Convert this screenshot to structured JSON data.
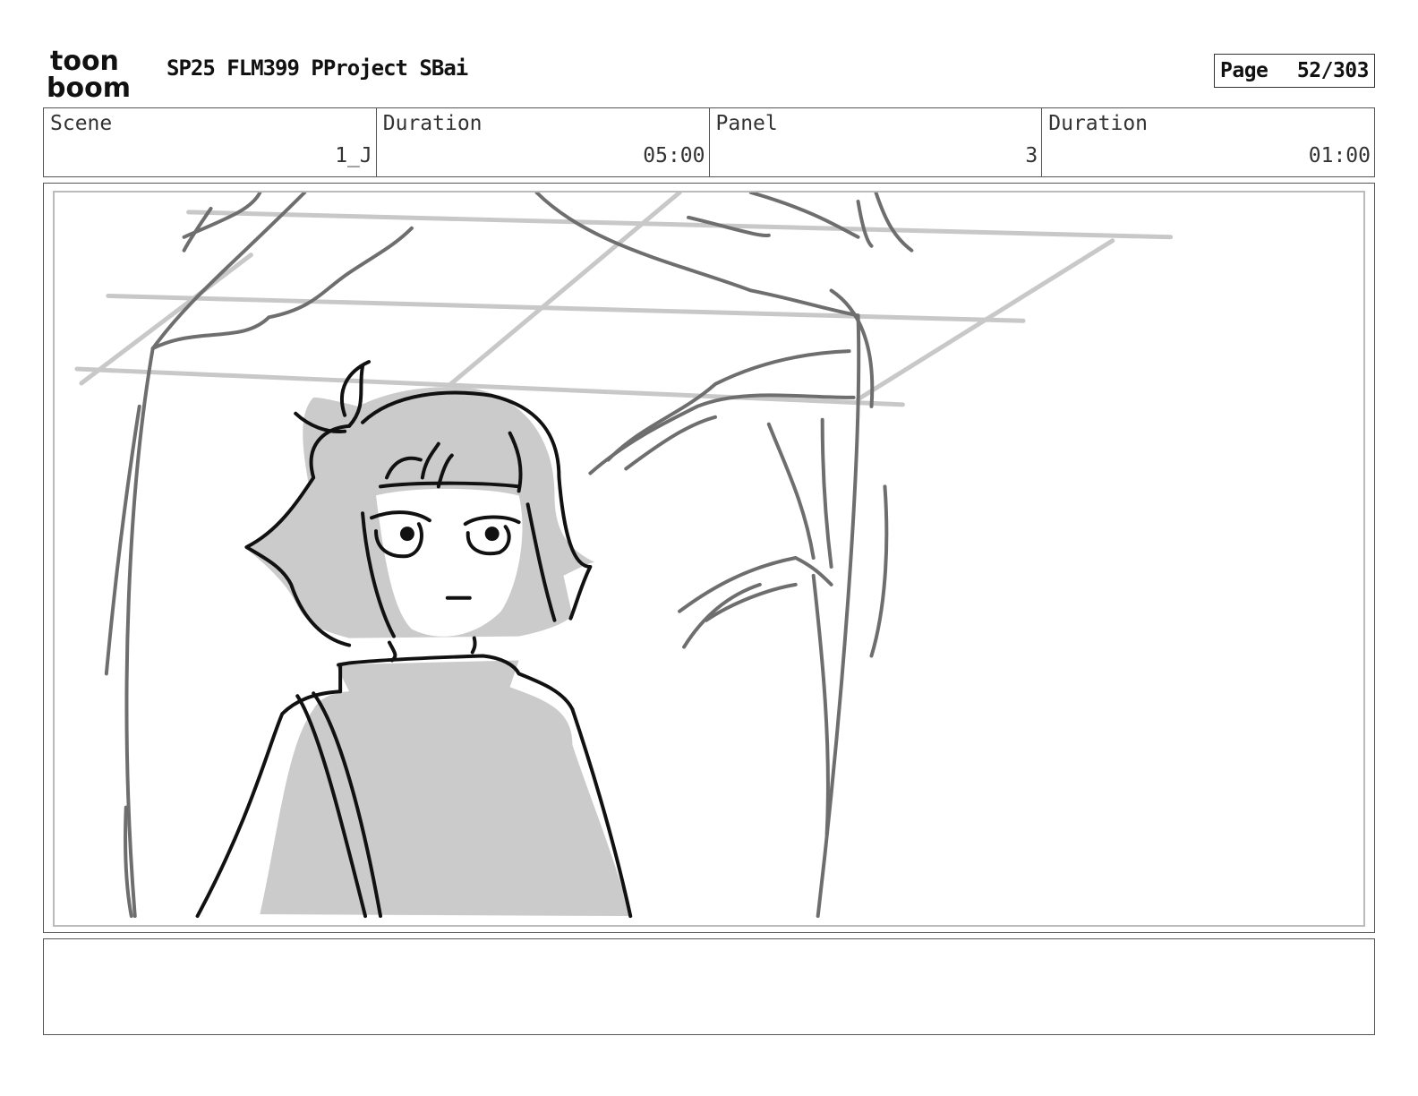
{
  "logo": {
    "line1": "toon",
    "line2": "boom"
  },
  "header": {
    "project_title": "SP25 FLM399 PProject SBai",
    "page_label": "Page",
    "page_value": "52/303"
  },
  "info": {
    "scene_label": "Scene",
    "scene_value": "1_J",
    "scene_duration_label": "Duration",
    "scene_duration_value": "05:00",
    "panel_label": "Panel",
    "panel_value": "3",
    "panel_duration_label": "Duration",
    "panel_duration_value": "01:00"
  },
  "notes": {
    "text": ""
  }
}
